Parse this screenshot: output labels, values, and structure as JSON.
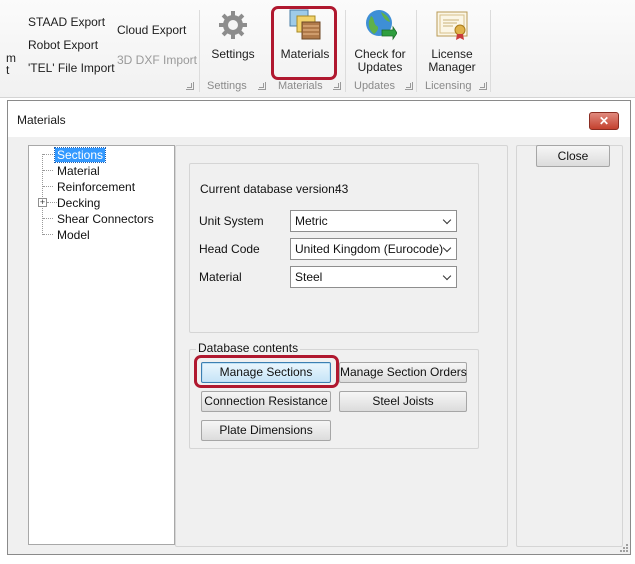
{
  "ribbon": {
    "left_cut_top": "m",
    "left_cut_bottom": "t",
    "export_items": [
      "STAAD Export",
      "Robot Export",
      "'TEL' File Import"
    ],
    "cloud_export": "Cloud Export",
    "dxf_import": "3D DXF Import",
    "settings_label": "Settings",
    "materials_label": "Materials",
    "check_updates_label_1": "Check for",
    "check_updates_label_2": "Updates",
    "license_label_1": "License",
    "license_label_2": "Manager",
    "groups": {
      "settings": "Settings",
      "materials": "Materials",
      "updates": "Updates",
      "licensing": "Licensing"
    },
    "highlight_color": "#b0182f"
  },
  "dialog": {
    "title": "Materials",
    "close_glyph": "✕",
    "tree": {
      "items": [
        {
          "label": "Sections",
          "selected": true
        },
        {
          "label": "Material"
        },
        {
          "label": "Reinforcement"
        },
        {
          "label": "Decking",
          "expandable": true
        },
        {
          "label": "Shear Connectors"
        },
        {
          "label": "Model"
        }
      ],
      "expander_glyph": "+"
    },
    "db_version_label": "Current database version:",
    "db_version_value": "43",
    "fields": {
      "unit_system_label": "Unit System",
      "unit_system_value": "Metric",
      "head_code_label": "Head Code",
      "head_code_value": "United Kingdom (Eurocode)",
      "material_label": "Material",
      "material_value": "Steel"
    },
    "database_contents": {
      "legend": "Database contents",
      "manage_sections": "Manage Sections",
      "manage_section_orders": "Manage Section Orders",
      "connection_resistance": "Connection Resistance",
      "steel_joists": "Steel Joists",
      "plate_dimensions": "Plate Dimensions"
    },
    "close_button": "Close",
    "selection_color": "#3399ff"
  }
}
